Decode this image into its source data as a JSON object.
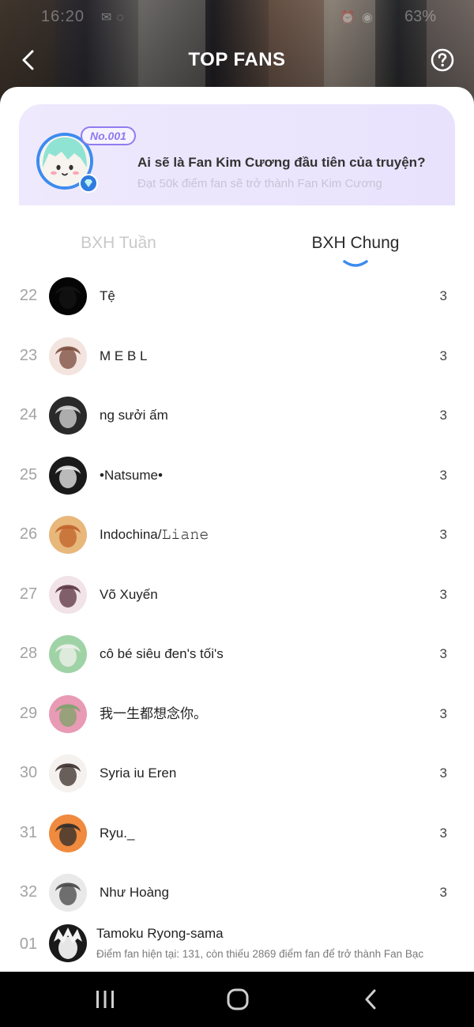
{
  "status_bar": {
    "time": "16:20",
    "battery": "63%"
  },
  "header": {
    "title": "TOP FANS",
    "back_icon": "chevron-left-icon",
    "help_icon": "question-circle-icon"
  },
  "banner": {
    "badge": "No.001",
    "title": "Ai sẽ là Fan Kim Cương đầu tiên của truyện?",
    "subtitle": "Đạt 50k điểm fan sẽ trở thành Fan Kim Cương",
    "gem_icon": "diamond-icon"
  },
  "tabs": [
    {
      "label": "BXH Tuần",
      "active": false
    },
    {
      "label": "BXH Chung",
      "active": true
    }
  ],
  "ranking": [
    {
      "rank": "22",
      "name": "Tệ",
      "score": "3",
      "avatar_color": "#050505",
      "avatar_accent": "#141414"
    },
    {
      "rank": "23",
      "name": "M E  B L",
      "score": "3",
      "avatar_color": "#f3e4df",
      "avatar_accent": "#7a4a3a"
    },
    {
      "rank": "24",
      "name": "ng sưởi ấm",
      "score": "3",
      "avatar_color": "#2a2a2a",
      "avatar_accent": "#d9d9d9"
    },
    {
      "rank": "25",
      "name": "•Natsume•",
      "score": "3",
      "avatar_color": "#1a1a1a",
      "avatar_accent": "#f0f0f0"
    },
    {
      "rank": "26",
      "name": "Indochina/𝙻𝚒𝚊𝚗𝚎",
      "score": "3",
      "avatar_color": "#e8b77a",
      "avatar_accent": "#c0612b"
    },
    {
      "rank": "27",
      "name": "Võ Xuyến",
      "score": "3",
      "avatar_color": "#f1e3e8",
      "avatar_accent": "#5a3340"
    },
    {
      "rank": "28",
      "name": "cô bé siêu đen's tối's",
      "score": "3",
      "avatar_color": "#9fd3a6",
      "avatar_accent": "#f1f1ee"
    },
    {
      "rank": "29",
      "name": "我一生都想念你。",
      "score": "3",
      "avatar_color": "#e99ab4",
      "avatar_accent": "#7ca26a"
    },
    {
      "rank": "30",
      "name": "Syria iu Eren",
      "score": "3",
      "avatar_color": "#f4f1ee",
      "avatar_accent": "#3a2e2a"
    },
    {
      "rank": "31",
      "name": "Ryu._",
      "score": "3",
      "avatar_color": "#f08a3e",
      "avatar_accent": "#2b2b2b"
    },
    {
      "rank": "32",
      "name": "Như Hoàng",
      "score": "3",
      "avatar_color": "#e9e9e9",
      "avatar_accent": "#444444"
    }
  ],
  "current_user": {
    "rank": "01",
    "name": "Tamoku Ryong-sama",
    "status": "Điểm fan hiện tại: 131, còn thiếu 2869 điểm fan để trở thành Fan Bạc"
  },
  "nav_bar": {
    "recent_icon": "recent-apps-icon",
    "home_icon": "home-icon",
    "back_icon": "back-icon"
  }
}
